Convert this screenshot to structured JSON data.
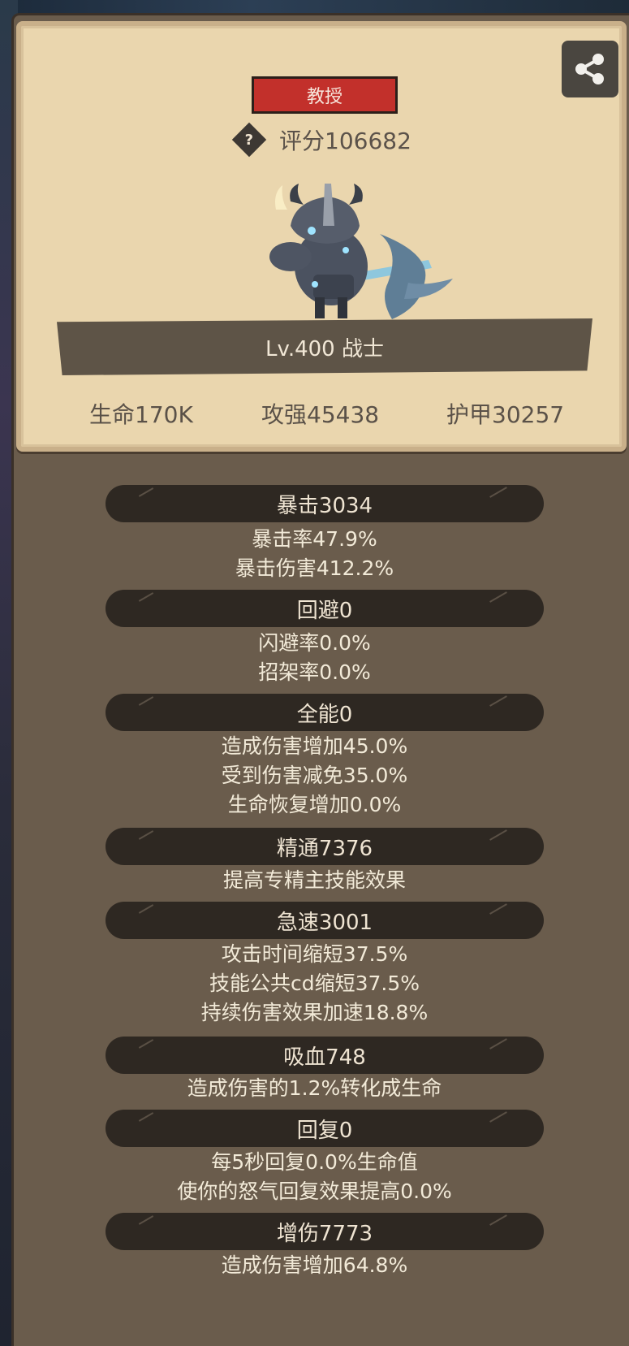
{
  "rank": "教授",
  "score_label": "评分106682",
  "level_label": "Lv.400 战士",
  "stats": {
    "hp": "生命170K",
    "atk": "攻强45438",
    "armor": "护甲30257"
  },
  "sections": [
    {
      "title": "暴击3034",
      "lines": [
        "暴击率47.9%",
        "暴击伤害412.2%"
      ]
    },
    {
      "title": "回避0",
      "lines": [
        "闪避率0.0%",
        "招架率0.0%"
      ]
    },
    {
      "title": "全能0",
      "lines": [
        "造成伤害增加45.0%",
        "受到伤害减免35.0%",
        "生命恢复增加0.0%"
      ]
    },
    {
      "title": "精通7376",
      "lines": [
        "提高专精主技能效果"
      ]
    },
    {
      "title": "急速3001",
      "lines": [
        "攻击时间缩短37.5%",
        "技能公共cd缩短37.5%",
        "持续伤害效果加速18.8%"
      ]
    },
    {
      "title": "吸血748",
      "lines": [
        "造成伤害的1.2%转化成生命"
      ]
    },
    {
      "title": "回复0",
      "lines": [
        "每5秒回复0.0%生命值",
        "使你的怒气回复效果提高0.0%"
      ]
    },
    {
      "title": "增伤7773",
      "lines": [
        "造成伤害增加64.8%"
      ]
    }
  ],
  "icons": {
    "share": "share-icon",
    "help": "question-icon"
  },
  "colors": {
    "panel": "#6a5c4c",
    "card": "#ead6ae",
    "rank_badge": "#c2302b",
    "section_bar": "#2e2822"
  }
}
